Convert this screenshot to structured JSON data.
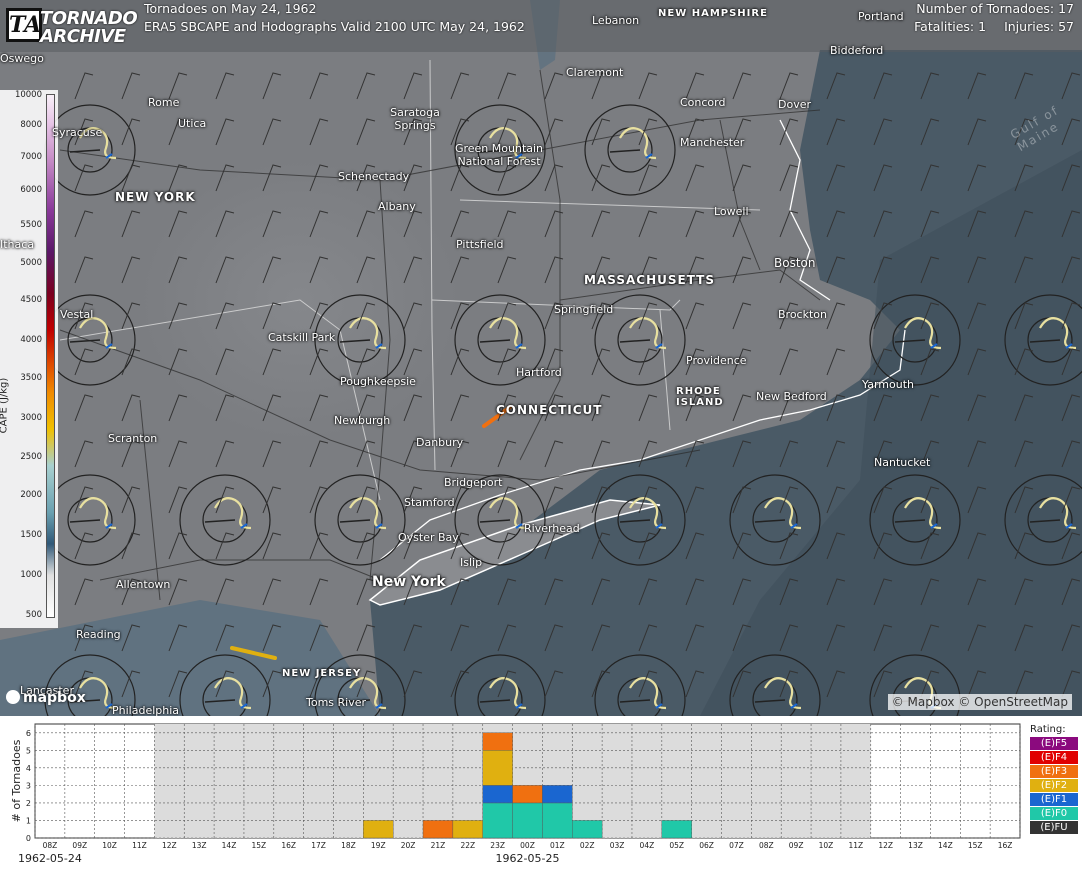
{
  "header": {
    "logo_mark": "TA",
    "logo_line1": "TORNADO",
    "logo_line2": "ARCHIVE",
    "title": "Tornadoes on May 24, 1962",
    "subtitle": "ERA5 SBCAPE and Hodographs Valid 2100 UTC May 24, 1962",
    "stats_line1": "Number of Tornadoes: 17",
    "fatalities": "Fatalities: 1",
    "injuries": "Injuries: 57"
  },
  "colorbar": {
    "label": "CAPE (J/kg)",
    "ticks": [
      "10000",
      "8000",
      "7000",
      "6000",
      "5500",
      "5000",
      "4500",
      "4000",
      "3500",
      "3000",
      "2500",
      "2000",
      "1500",
      "1000",
      "500"
    ]
  },
  "map_labels": {
    "states": [
      "NEW YORK",
      "MASSACHUSETTS",
      "CONNECTICUT",
      "RHODE ISLAND",
      "NEW JERSEY",
      "NEW HAMPSHIRE"
    ],
    "big_cities": [
      "New York",
      "Boston"
    ],
    "cities": [
      "Rome",
      "Utica",
      "Saratoga Springs",
      "Schenectady",
      "Albany",
      "Syracuse",
      "Ithaca",
      "Vestal",
      "Catskill Park",
      "Poughkeepsie",
      "Newburgh",
      "Scranton",
      "Danbury",
      "Bridgeport",
      "Stamford",
      "Oyster Bay",
      "Islip",
      "Riverhead",
      "Hartford",
      "Springfield",
      "Pittsfield",
      "Providence",
      "New Bedford",
      "Brockton",
      "Yarmouth",
      "Nantucket",
      "Lowell",
      "Manchester",
      "Concord",
      "Dover",
      "Portland",
      "Biddeford",
      "Claremont",
      "Lebanon",
      "Green Mountain National Forest",
      "Allentown",
      "Reading",
      "Lancaster",
      "Philadelphia",
      "Toms River",
      "Oswego"
    ],
    "sea": "Gulf of Maine"
  },
  "attribution": {
    "mapbox": "mapbox",
    "credit": "© Mapbox © OpenStreetMap"
  },
  "chart_data": {
    "type": "bar",
    "stacked": true,
    "ylabel": "# of Tornadoes",
    "ylim": [
      0,
      6.5
    ],
    "yticks": [
      0,
      1,
      2,
      3,
      4,
      5,
      6
    ],
    "categories": [
      "08Z",
      "09Z",
      "10Z",
      "11Z",
      "12Z",
      "13Z",
      "14Z",
      "15Z",
      "16Z",
      "17Z",
      "18Z",
      "19Z",
      "20Z",
      "21Z",
      "22Z",
      "23Z",
      "00Z",
      "01Z",
      "02Z",
      "03Z",
      "04Z",
      "05Z",
      "06Z",
      "07Z",
      "08Z",
      "09Z",
      "10Z",
      "11Z",
      "12Z",
      "13Z",
      "14Z",
      "15Z",
      "16Z"
    ],
    "date_labels": [
      {
        "at": "08Z",
        "text": "1962-05-24"
      },
      {
        "at": "00Z",
        "text": "1962-05-25"
      }
    ],
    "shaded_range": [
      "12Z",
      "12Z"
    ],
    "bars": [
      {
        "category": "19Z",
        "segments": [
          {
            "rating": "(E)F2",
            "count": 1
          }
        ]
      },
      {
        "category": "21Z",
        "segments": [
          {
            "rating": "(E)F3",
            "count": 1
          }
        ]
      },
      {
        "category": "22Z",
        "segments": [
          {
            "rating": "(E)F2",
            "count": 1
          }
        ]
      },
      {
        "category": "23Z",
        "segments": [
          {
            "rating": "(E)F0",
            "count": 2
          },
          {
            "rating": "(E)F1",
            "count": 1
          },
          {
            "rating": "(E)F2",
            "count": 2
          },
          {
            "rating": "(E)F3",
            "count": 1
          }
        ]
      },
      {
        "category": "00Z",
        "segments": [
          {
            "rating": "(E)F0",
            "count": 2
          },
          {
            "rating": "(E)F3",
            "count": 1
          }
        ]
      },
      {
        "category": "01Z",
        "segments": [
          {
            "rating": "(E)F0",
            "count": 2
          },
          {
            "rating": "(E)F1",
            "count": 1
          }
        ]
      },
      {
        "category": "02Z",
        "segments": [
          {
            "rating": "(E)F0",
            "count": 1
          }
        ]
      },
      {
        "category": "05Z",
        "segments": [
          {
            "rating": "(E)F0",
            "count": 1
          }
        ]
      }
    ],
    "legend_title": "Rating:",
    "legend": [
      {
        "label": "(E)F5",
        "color": "#8b0a7e"
      },
      {
        "label": "(E)F4",
        "color": "#e00000"
      },
      {
        "label": "(E)F3",
        "color": "#f07010"
      },
      {
        "label": "(E)F2",
        "color": "#e0b010"
      },
      {
        "label": "(E)F1",
        "color": "#1a66d0"
      },
      {
        "label": "(E)F0",
        "color": "#20c8a8"
      },
      {
        "label": "(E)FU",
        "color": "#333333"
      }
    ]
  }
}
